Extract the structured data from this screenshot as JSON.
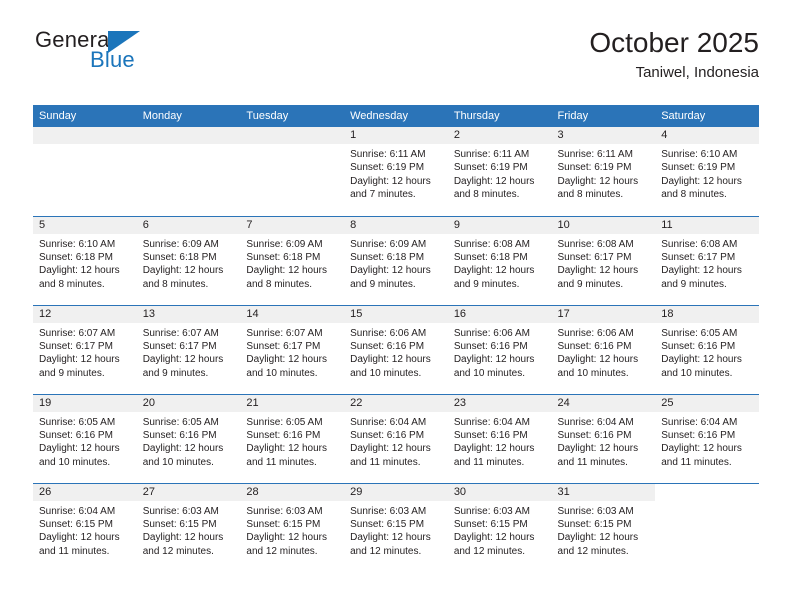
{
  "logo": {
    "line1": "General",
    "line2": "Blue",
    "triangle_color": "#1b75bb"
  },
  "header": {
    "title": "October 2025",
    "location": "Taniwel, Indonesia"
  },
  "theme": {
    "header_blue": "#2b74b8",
    "daynum_grey": "#f0f0f0",
    "text": "#231f20"
  },
  "weekdays": [
    "Sunday",
    "Monday",
    "Tuesday",
    "Wednesday",
    "Thursday",
    "Friday",
    "Saturday"
  ],
  "chart_data": {
    "type": "table",
    "title": "October 2025",
    "subtitle": "Taniwel, Indonesia",
    "columns": [
      "Sunday",
      "Monday",
      "Tuesday",
      "Wednesday",
      "Thursday",
      "Friday",
      "Saturday"
    ],
    "fields": [
      "day",
      "sunrise",
      "sunset",
      "daylight"
    ],
    "rows": [
      [
        {
          "day": "",
          "empty": true
        },
        {
          "day": "",
          "empty": true
        },
        {
          "day": "",
          "empty": true
        },
        {
          "day": "1",
          "sunrise": "Sunrise: 6:11 AM",
          "sunset": "Sunset: 6:19 PM",
          "daylight_line1": "Daylight: 12 hours",
          "daylight_line2": "and 7 minutes."
        },
        {
          "day": "2",
          "sunrise": "Sunrise: 6:11 AM",
          "sunset": "Sunset: 6:19 PM",
          "daylight_line1": "Daylight: 12 hours",
          "daylight_line2": "and 8 minutes."
        },
        {
          "day": "3",
          "sunrise": "Sunrise: 6:11 AM",
          "sunset": "Sunset: 6:19 PM",
          "daylight_line1": "Daylight: 12 hours",
          "daylight_line2": "and 8 minutes."
        },
        {
          "day": "4",
          "sunrise": "Sunrise: 6:10 AM",
          "sunset": "Sunset: 6:19 PM",
          "daylight_line1": "Daylight: 12 hours",
          "daylight_line2": "and 8 minutes."
        }
      ],
      [
        {
          "day": "5",
          "sunrise": "Sunrise: 6:10 AM",
          "sunset": "Sunset: 6:18 PM",
          "daylight_line1": "Daylight: 12 hours",
          "daylight_line2": "and 8 minutes."
        },
        {
          "day": "6",
          "sunrise": "Sunrise: 6:09 AM",
          "sunset": "Sunset: 6:18 PM",
          "daylight_line1": "Daylight: 12 hours",
          "daylight_line2": "and 8 minutes."
        },
        {
          "day": "7",
          "sunrise": "Sunrise: 6:09 AM",
          "sunset": "Sunset: 6:18 PM",
          "daylight_line1": "Daylight: 12 hours",
          "daylight_line2": "and 8 minutes."
        },
        {
          "day": "8",
          "sunrise": "Sunrise: 6:09 AM",
          "sunset": "Sunset: 6:18 PM",
          "daylight_line1": "Daylight: 12 hours",
          "daylight_line2": "and 9 minutes."
        },
        {
          "day": "9",
          "sunrise": "Sunrise: 6:08 AM",
          "sunset": "Sunset: 6:18 PM",
          "daylight_line1": "Daylight: 12 hours",
          "daylight_line2": "and 9 minutes."
        },
        {
          "day": "10",
          "sunrise": "Sunrise: 6:08 AM",
          "sunset": "Sunset: 6:17 PM",
          "daylight_line1": "Daylight: 12 hours",
          "daylight_line2": "and 9 minutes."
        },
        {
          "day": "11",
          "sunrise": "Sunrise: 6:08 AM",
          "sunset": "Sunset: 6:17 PM",
          "daylight_line1": "Daylight: 12 hours",
          "daylight_line2": "and 9 minutes."
        }
      ],
      [
        {
          "day": "12",
          "sunrise": "Sunrise: 6:07 AM",
          "sunset": "Sunset: 6:17 PM",
          "daylight_line1": "Daylight: 12 hours",
          "daylight_line2": "and 9 minutes."
        },
        {
          "day": "13",
          "sunrise": "Sunrise: 6:07 AM",
          "sunset": "Sunset: 6:17 PM",
          "daylight_line1": "Daylight: 12 hours",
          "daylight_line2": "and 9 minutes."
        },
        {
          "day": "14",
          "sunrise": "Sunrise: 6:07 AM",
          "sunset": "Sunset: 6:17 PM",
          "daylight_line1": "Daylight: 12 hours",
          "daylight_line2": "and 10 minutes."
        },
        {
          "day": "15",
          "sunrise": "Sunrise: 6:06 AM",
          "sunset": "Sunset: 6:16 PM",
          "daylight_line1": "Daylight: 12 hours",
          "daylight_line2": "and 10 minutes."
        },
        {
          "day": "16",
          "sunrise": "Sunrise: 6:06 AM",
          "sunset": "Sunset: 6:16 PM",
          "daylight_line1": "Daylight: 12 hours",
          "daylight_line2": "and 10 minutes."
        },
        {
          "day": "17",
          "sunrise": "Sunrise: 6:06 AM",
          "sunset": "Sunset: 6:16 PM",
          "daylight_line1": "Daylight: 12 hours",
          "daylight_line2": "and 10 minutes."
        },
        {
          "day": "18",
          "sunrise": "Sunrise: 6:05 AM",
          "sunset": "Sunset: 6:16 PM",
          "daylight_line1": "Daylight: 12 hours",
          "daylight_line2": "and 10 minutes."
        }
      ],
      [
        {
          "day": "19",
          "sunrise": "Sunrise: 6:05 AM",
          "sunset": "Sunset: 6:16 PM",
          "daylight_line1": "Daylight: 12 hours",
          "daylight_line2": "and 10 minutes."
        },
        {
          "day": "20",
          "sunrise": "Sunrise: 6:05 AM",
          "sunset": "Sunset: 6:16 PM",
          "daylight_line1": "Daylight: 12 hours",
          "daylight_line2": "and 10 minutes."
        },
        {
          "day": "21",
          "sunrise": "Sunrise: 6:05 AM",
          "sunset": "Sunset: 6:16 PM",
          "daylight_line1": "Daylight: 12 hours",
          "daylight_line2": "and 11 minutes."
        },
        {
          "day": "22",
          "sunrise": "Sunrise: 6:04 AM",
          "sunset": "Sunset: 6:16 PM",
          "daylight_line1": "Daylight: 12 hours",
          "daylight_line2": "and 11 minutes."
        },
        {
          "day": "23",
          "sunrise": "Sunrise: 6:04 AM",
          "sunset": "Sunset: 6:16 PM",
          "daylight_line1": "Daylight: 12 hours",
          "daylight_line2": "and 11 minutes."
        },
        {
          "day": "24",
          "sunrise": "Sunrise: 6:04 AM",
          "sunset": "Sunset: 6:16 PM",
          "daylight_line1": "Daylight: 12 hours",
          "daylight_line2": "and 11 minutes."
        },
        {
          "day": "25",
          "sunrise": "Sunrise: 6:04 AM",
          "sunset": "Sunset: 6:16 PM",
          "daylight_line1": "Daylight: 12 hours",
          "daylight_line2": "and 11 minutes."
        }
      ],
      [
        {
          "day": "26",
          "sunrise": "Sunrise: 6:04 AM",
          "sunset": "Sunset: 6:15 PM",
          "daylight_line1": "Daylight: 12 hours",
          "daylight_line2": "and 11 minutes."
        },
        {
          "day": "27",
          "sunrise": "Sunrise: 6:03 AM",
          "sunset": "Sunset: 6:15 PM",
          "daylight_line1": "Daylight: 12 hours",
          "daylight_line2": "and 12 minutes."
        },
        {
          "day": "28",
          "sunrise": "Sunrise: 6:03 AM",
          "sunset": "Sunset: 6:15 PM",
          "daylight_line1": "Daylight: 12 hours",
          "daylight_line2": "and 12 minutes."
        },
        {
          "day": "29",
          "sunrise": "Sunrise: 6:03 AM",
          "sunset": "Sunset: 6:15 PM",
          "daylight_line1": "Daylight: 12 hours",
          "daylight_line2": "and 12 minutes."
        },
        {
          "day": "30",
          "sunrise": "Sunrise: 6:03 AM",
          "sunset": "Sunset: 6:15 PM",
          "daylight_line1": "Daylight: 12 hours",
          "daylight_line2": "and 12 minutes."
        },
        {
          "day": "31",
          "sunrise": "Sunrise: 6:03 AM",
          "sunset": "Sunset: 6:15 PM",
          "daylight_line1": "Daylight: 12 hours",
          "daylight_line2": "and 12 minutes."
        },
        {
          "day": "",
          "empty": true,
          "no_band": true
        }
      ]
    ]
  }
}
